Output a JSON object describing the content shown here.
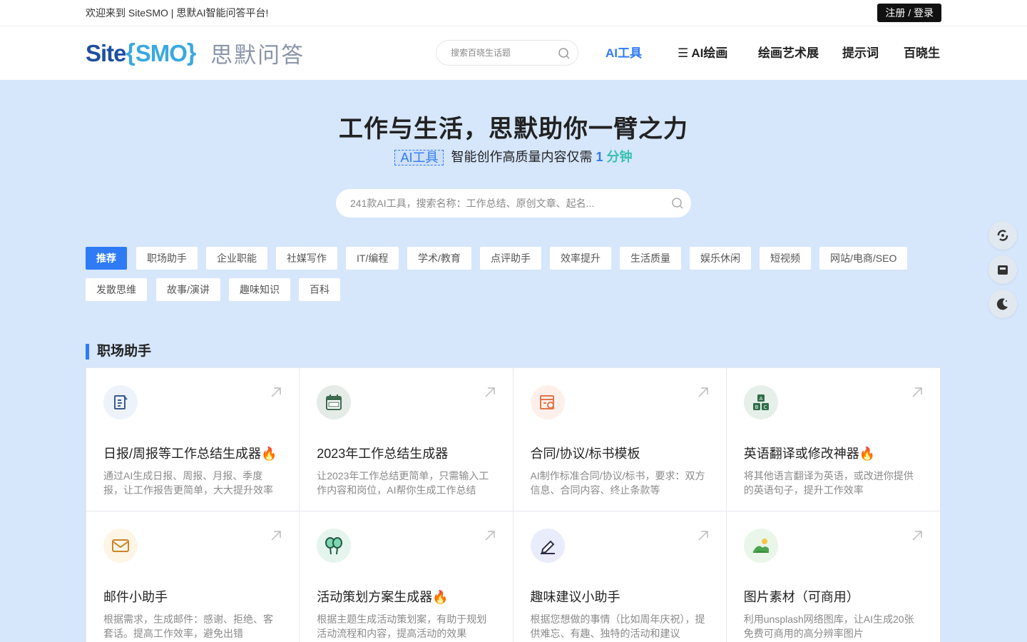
{
  "topbar": {
    "welcome": "欢迎来到 SiteSMO | 思默AI智能问答平台!",
    "login": "注册 / 登录"
  },
  "header": {
    "logo_site": "Site",
    "logo_brace_open": "{",
    "logo_smo": "SMO",
    "logo_brace_close": "}",
    "logo_cn": "思默问答",
    "search_placeholder": "搜索百晓生话题",
    "nav": [
      "AI工具",
      "☰ AI绘画",
      "绘画艺术展",
      "提示词",
      "百晓生"
    ],
    "active_nav": "AI工具"
  },
  "hero": {
    "title": "工作与生活，思默助你一臂之力",
    "tag": "AI工具",
    "sub_text": "智能创作高质量内容仅需",
    "sub_num": "1",
    "sub_unit": "分钟",
    "search_placeholder": "241款AI工具，搜索名称：工作总结、原创文章、起名..."
  },
  "categories": [
    "推荐",
    "职场助手",
    "企业职能",
    "社媒写作",
    "IT/编程",
    "学术/教育",
    "点评助手",
    "效率提升",
    "生活质量",
    "娱乐休闲",
    "短视频",
    "网站/电商/SEO",
    "发散思维",
    "故事/演讲",
    "趣味知识",
    "百科"
  ],
  "section": {
    "title": "职场助手",
    "cards": [
      {
        "name": "日报/周报等工作总结生成器🔥",
        "desc": "通过AI生成日报、周报、月报、季度报，让工作报告更简单，大大提升效率",
        "icon": "report-icon",
        "bg": "#eef3fb",
        "color": "#3b5b8f"
      },
      {
        "name": "2023年工作总结生成器",
        "desc": "让2023年工作总结更简单，只需输入工作内容和岗位，AI帮你生成工作总结",
        "icon": "calendar-icon",
        "bg": "#e5ebe7",
        "color": "#3e6b50"
      },
      {
        "name": "合同/协议/标书模板",
        "desc": "AI制作标准合同/协议/标书，要求：双方信息、合同内容、终止条款等",
        "icon": "contract-icon",
        "bg": "#fdf0ea",
        "color": "#e0774a"
      },
      {
        "name": "英语翻译或修改神器🔥",
        "desc": "将其他语言翻译为英语，或改进你提供的英语句子，提升工作效率",
        "icon": "abc-blocks-icon",
        "bg": "#e6efe9",
        "color": "#2f6e4a"
      },
      {
        "name": "邮件小助手",
        "desc": "根据需求，生成邮件：感谢、拒绝、客套话。提高工作效率，避免出错",
        "icon": "mail-icon",
        "bg": "#fdf6e6",
        "color": "#c9862a"
      },
      {
        "name": "活动策划方案生成器🔥",
        "desc": "根据主题生成活动策划案，有助于规划活动流程和内容，提高活动的效果",
        "icon": "balloons-icon",
        "bg": "#e5f5ee",
        "color": "#2e9b6d"
      },
      {
        "name": "趣味建议小助手",
        "desc": "根据您想做的事情（比如周年庆祝），提供难忘、有趣、独特的活动和建议",
        "icon": "edit-pen-icon",
        "bg": "#e9ecfa",
        "color": "#4b57a8"
      },
      {
        "name": "图片素材（可商用）",
        "desc": "利用unsplash网络图库，让AI生成20张免费可商用的高分辨率图片",
        "icon": "landscape-icon",
        "bg": "#eaf6ea",
        "color": "#4aa54c"
      }
    ]
  },
  "side_buttons": [
    "refresh-icon",
    "inbox-icon",
    "moon-icon"
  ],
  "colors": {
    "accent": "#2f7bf5",
    "page_bg": "#d6e6fb"
  }
}
